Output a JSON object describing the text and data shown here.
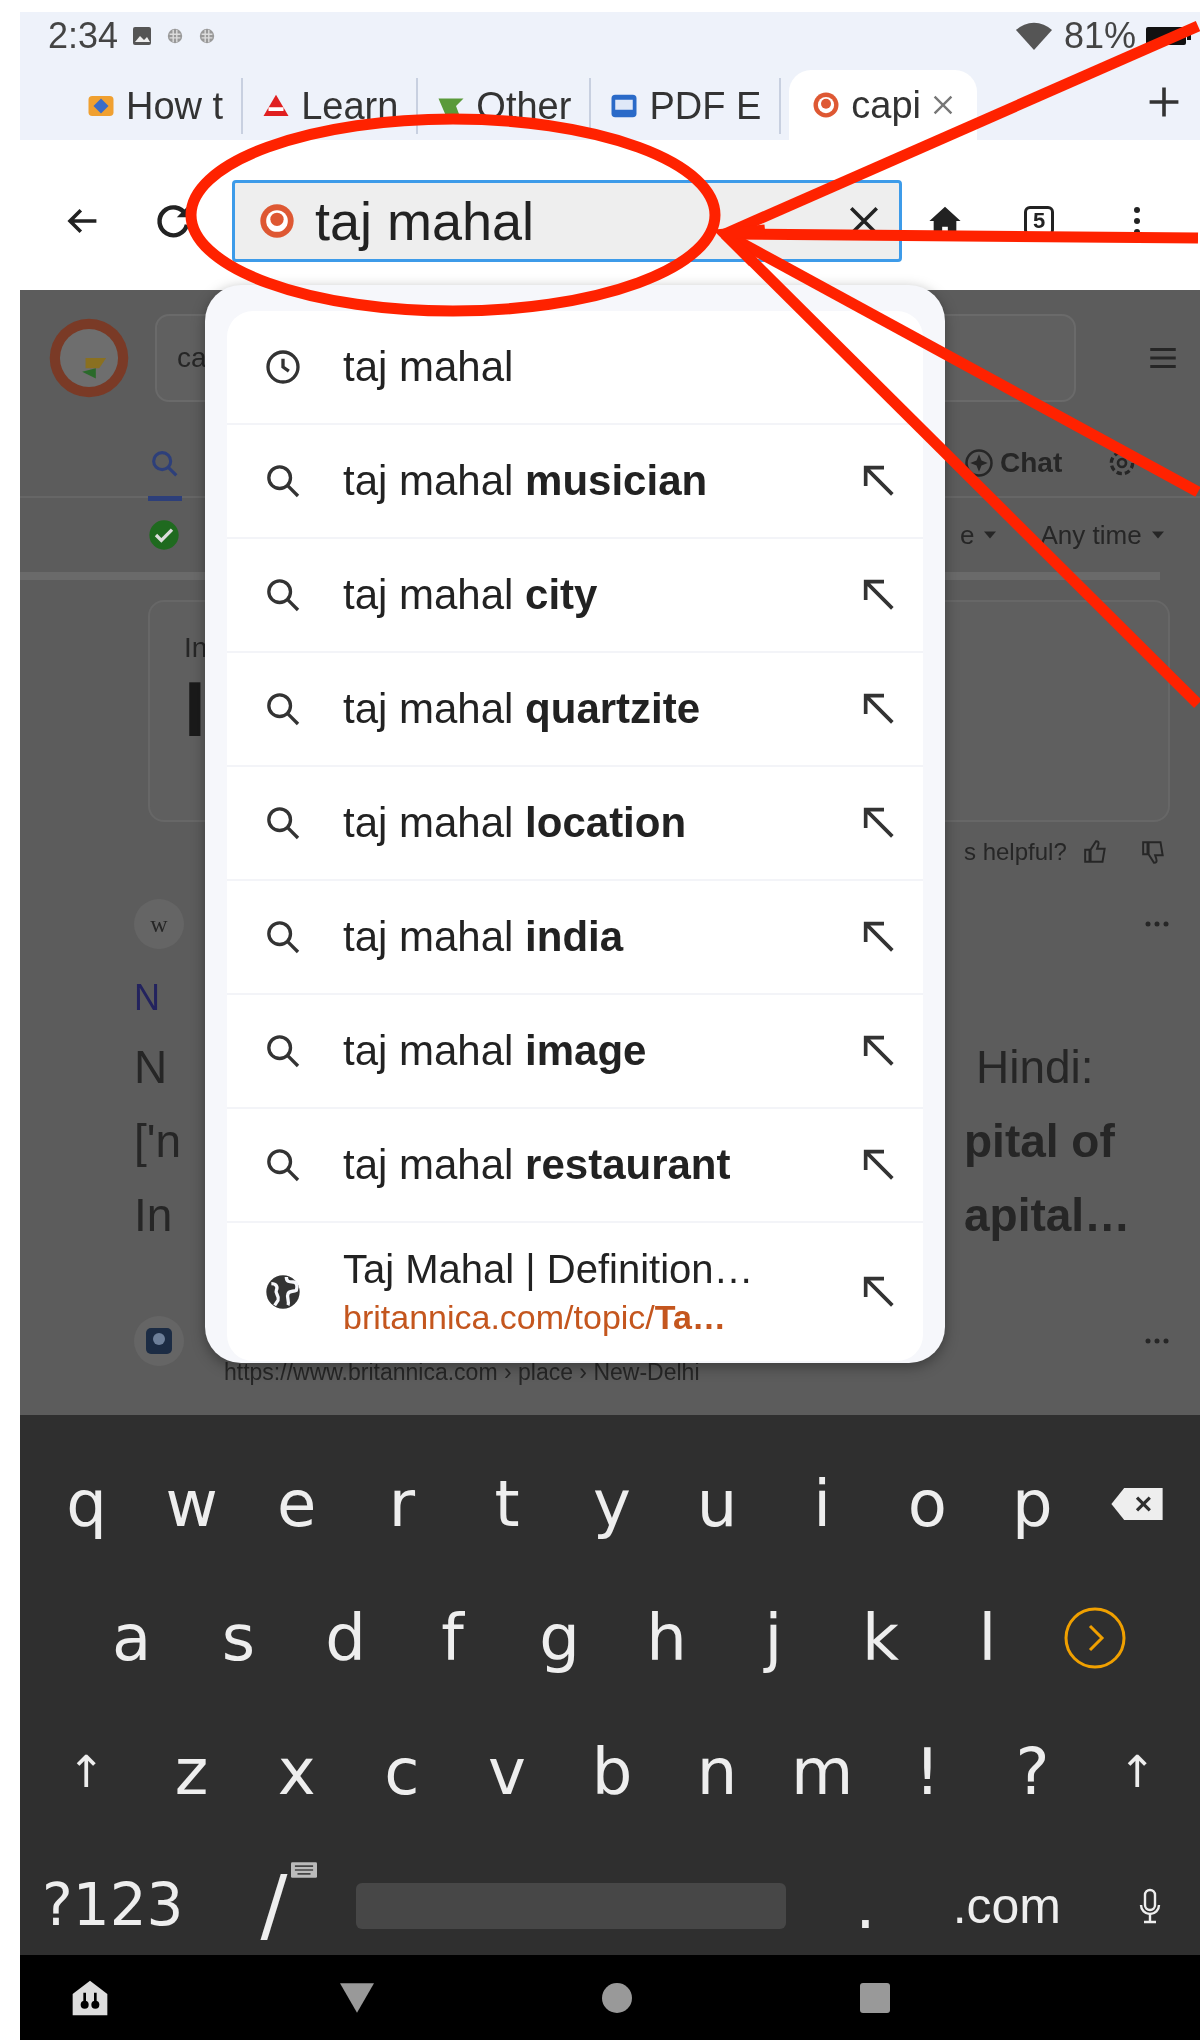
{
  "status_bar": {
    "time": "2:34",
    "battery": "81%"
  },
  "tabs": [
    {
      "title": "How t",
      "selected": false
    },
    {
      "title": "Learn",
      "selected": false
    },
    {
      "title": "Other",
      "selected": false
    },
    {
      "title": "PDF E",
      "selected": false
    },
    {
      "title": "capi",
      "selected": true
    }
  ],
  "toolbar": {
    "url_field": {
      "value": "taj mahal"
    },
    "tab_count": "5"
  },
  "page": {
    "search_field": {
      "value": "ca"
    },
    "chat_label": "Chat",
    "filters": [
      "e",
      "Any time"
    ],
    "card": {
      "label": "In",
      "heading": "I"
    },
    "feedback": "s helpful?",
    "result_1": {
      "favicon": "w",
      "link": "N",
      "lines": [
        {
          "left": "N",
          "right": "Hindi:"
        },
        {
          "left": "['n",
          "right": "pital of"
        },
        {
          "left": "In",
          "right": "apital…"
        }
      ]
    },
    "result_2": {
      "url": "https://www.britannica.com › place › New-Delhi"
    }
  },
  "suggestions": [
    {
      "kind": "history",
      "text": "taj mahal"
    },
    {
      "kind": "search",
      "text": "taj mahal **musician**"
    },
    {
      "kind": "search",
      "text": "taj mahal **city**"
    },
    {
      "kind": "search",
      "text": "taj mahal **quartzite**"
    },
    {
      "kind": "search",
      "text": "taj mahal **location**"
    },
    {
      "kind": "search",
      "text": "taj mahal **india**"
    },
    {
      "kind": "search",
      "text": "taj mahal **image**"
    },
    {
      "kind": "search",
      "text": "taj mahal **restaurant**"
    },
    {
      "kind": "site",
      "title": "Taj Mahal | Definition…",
      "url": "britannica.com/topic/**Ta…**"
    }
  ],
  "keyboard": {
    "rows": [
      [
        {
          "kind": "char",
          "label": "q"
        },
        {
          "kind": "char",
          "label": "w"
        },
        {
          "kind": "char",
          "label": "e"
        },
        {
          "kind": "char",
          "label": "r"
        },
        {
          "kind": "char",
          "label": "t"
        },
        {
          "kind": "char",
          "label": "y"
        },
        {
          "kind": "char",
          "label": "u"
        },
        {
          "kind": "char",
          "label": "i"
        },
        {
          "kind": "char",
          "label": "o"
        },
        {
          "kind": "char",
          "label": "p"
        },
        {
          "kind": "backspace"
        }
      ],
      [
        {
          "kind": "char",
          "label": "a"
        },
        {
          "kind": "char",
          "label": "s"
        },
        {
          "kind": "char",
          "label": "d"
        },
        {
          "kind": "char",
          "label": "f"
        },
        {
          "kind": "char",
          "label": "g"
        },
        {
          "kind": "char",
          "label": "h"
        },
        {
          "kind": "char",
          "label": "j"
        },
        {
          "kind": "char",
          "label": "k"
        },
        {
          "kind": "char",
          "label": "l"
        },
        {
          "kind": "enter"
        }
      ],
      [
        {
          "kind": "shift",
          "label": "↑"
        },
        {
          "kind": "char",
          "label": "z"
        },
        {
          "kind": "char",
          "label": "x"
        },
        {
          "kind": "char",
          "label": "c"
        },
        {
          "kind": "char",
          "label": "v"
        },
        {
          "kind": "char",
          "label": "b"
        },
        {
          "kind": "char",
          "label": "n"
        },
        {
          "kind": "char",
          "label": "m"
        },
        {
          "kind": "char",
          "label": "!"
        },
        {
          "kind": "char",
          "label": "?"
        },
        {
          "kind": "shift",
          "label": "↑"
        }
      ]
    ],
    "bottom_row": [
      {
        "kind": "mode",
        "label": "?123"
      },
      {
        "kind": "slash",
        "label": "/"
      },
      {
        "kind": "space"
      },
      {
        "kind": "char",
        "label": "."
      },
      {
        "kind": "char",
        "label": ".com"
      },
      {
        "kind": "mic"
      }
    ]
  }
}
